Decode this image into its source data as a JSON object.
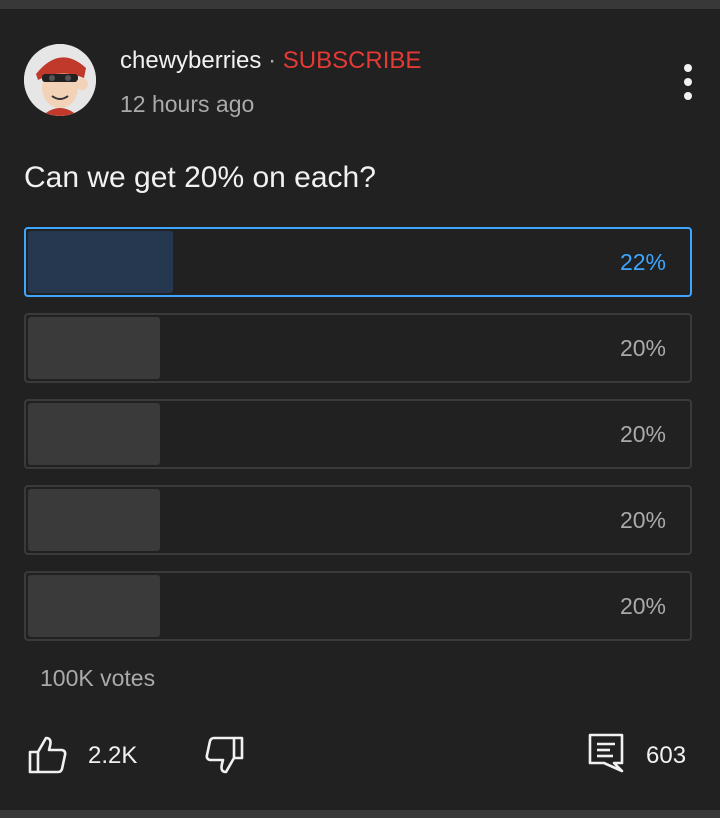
{
  "post": {
    "channel_name": "chewyberries",
    "separator": "·",
    "subscribe_label": "SUBSCRIBE",
    "time_ago": "12 hours ago",
    "question": "Can we get 20% on each?"
  },
  "poll": {
    "options": [
      {
        "percent_label": "22%",
        "percent": 22,
        "selected": true
      },
      {
        "percent_label": "20%",
        "percent": 20,
        "selected": false
      },
      {
        "percent_label": "20%",
        "percent": 20,
        "selected": false
      },
      {
        "percent_label": "20%",
        "percent": 20,
        "selected": false
      },
      {
        "percent_label": "20%",
        "percent": 20,
        "selected": false
      }
    ],
    "votes_label": "100K votes"
  },
  "actions": {
    "like_count": "2.2K",
    "comment_count": "603",
    "icons": [
      "thumbs-up-icon",
      "thumbs-down-icon",
      "comment-icon",
      "more-vert-icon"
    ]
  },
  "colors": {
    "background": "#212121",
    "accent_blue": "#3ea6ff",
    "subscribe_red": "#e53935",
    "text_primary": "#f1f1f1",
    "text_secondary": "#aaaaaa"
  }
}
